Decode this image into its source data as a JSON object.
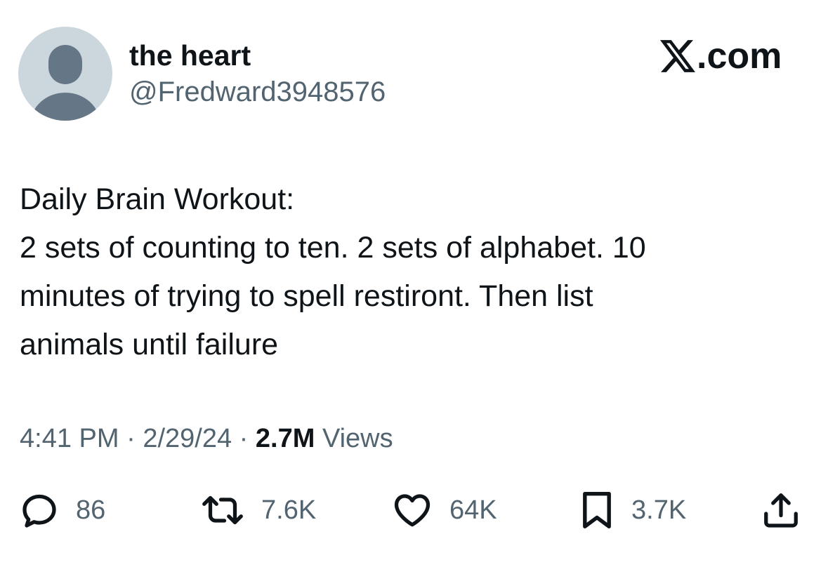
{
  "author": {
    "display_name": "the heart",
    "handle": "@Fredward3948576"
  },
  "brand": {
    "suffix": ".com"
  },
  "tweet": {
    "lines": [
      "Daily Brain Workout:",
      "2 sets of counting to ten. 2 sets of alphabet. 10",
      "minutes of trying to spell restiront. Then list",
      "animals until failure"
    ]
  },
  "meta": {
    "time": "4:41 PM",
    "date": "2/29/24",
    "separator": "·",
    "views_count": "2.7M",
    "views_label": "Views"
  },
  "actions": {
    "replies": "86",
    "reposts": "7.6K",
    "likes": "64K",
    "bookmarks": "3.7K"
  },
  "icons": {
    "avatar": "default-avatar-icon",
    "brand": "x-logo-icon",
    "reply": "reply-icon",
    "repost": "repost-icon",
    "like": "heart-icon",
    "bookmark": "bookmark-icon",
    "share": "share-icon"
  },
  "colors": {
    "text_primary": "#0f1419",
    "text_secondary": "#536471",
    "avatar_bg": "#ccd6dd",
    "avatar_fg": "#657786"
  }
}
